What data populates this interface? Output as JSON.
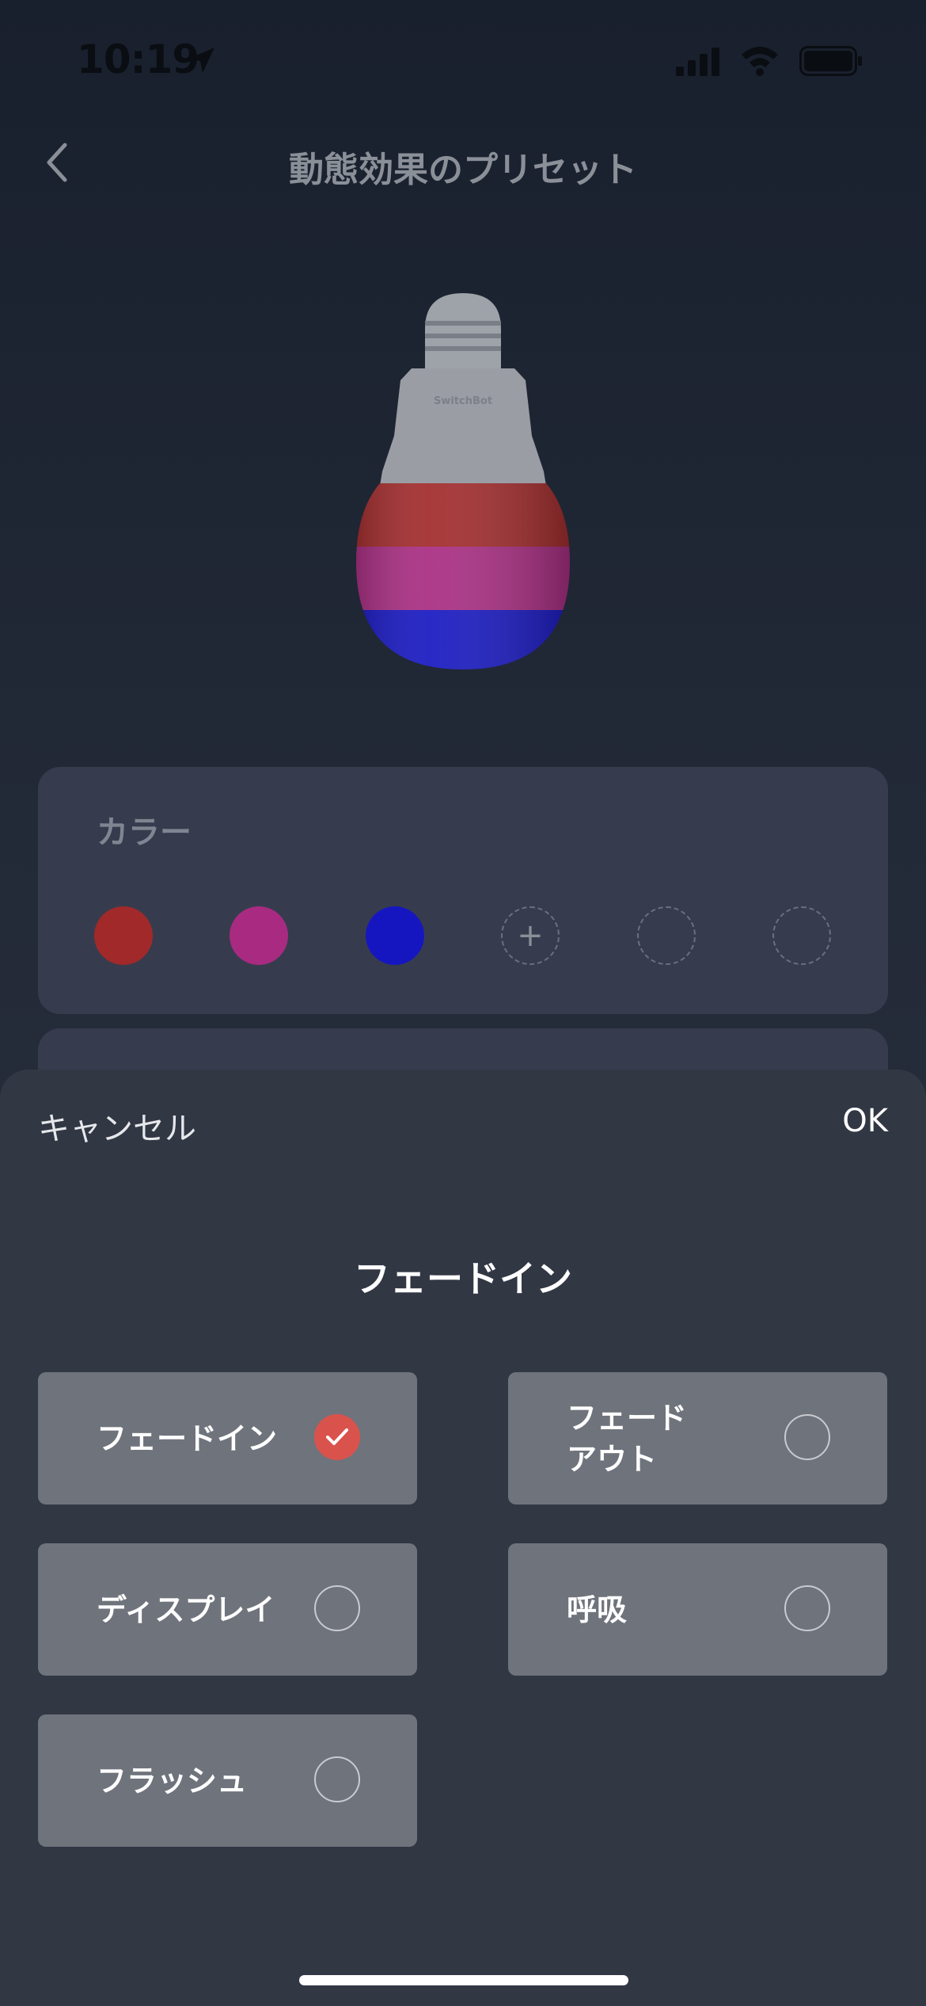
{
  "status_bar": {
    "time": "10:19"
  },
  "nav": {
    "title": "動態効果のプリセット"
  },
  "color_card": {
    "label": "カラー",
    "swatches": [
      "#a1292a",
      "#a82b81",
      "#1616c1"
    ],
    "add_symbol": "+"
  },
  "sheet": {
    "cancel_label": "キャンセル",
    "ok_label": "OK",
    "title": "フェードイン",
    "options": [
      {
        "label": "フェードイン",
        "checked": true
      },
      {
        "label": "フェード\nアウト",
        "checked": false
      },
      {
        "label": "ディスプレイ",
        "checked": false
      },
      {
        "label": "呼吸",
        "checked": false
      },
      {
        "label": "フラッシュ",
        "checked": false
      }
    ]
  },
  "bulb": {
    "brand": "SwitchBot",
    "bands": [
      "#a1292a",
      "#a82b81",
      "#1616c1"
    ]
  },
  "colors": {
    "accent": "#d9534c",
    "sheet": "#323744",
    "card": "#363c4d",
    "option": "#6f737c"
  }
}
